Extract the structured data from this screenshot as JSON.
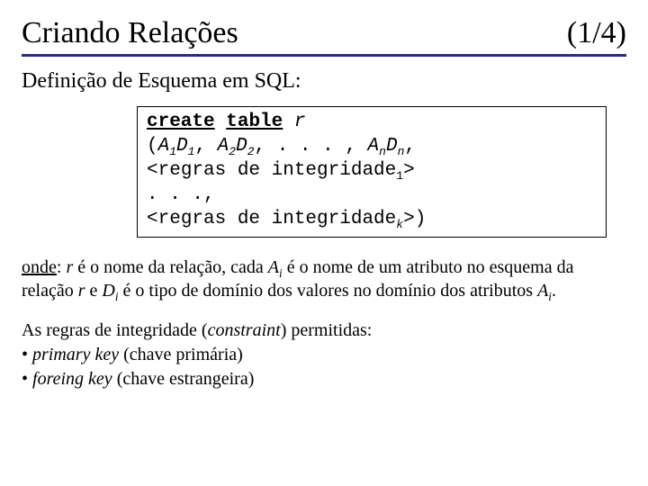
{
  "title": "Criando Relações",
  "page_label": "(1/4)",
  "subtitle": "Definição de Esquema em SQL:",
  "code": {
    "kw_create": "create",
    "kw_table": "table",
    "r": "r",
    "lparen": "(",
    "A": "A",
    "D": "D",
    "s1": "1",
    "s2": "2",
    "sn": "n",
    "comma_sp": ", ",
    "ellipsis_comma": " . . . , ",
    "lt": "<",
    "gt": ">",
    "rule_txt": "regras de integridade",
    "sk": "k",
    "ellipsis_line": ". . .,",
    "rparen": ")"
  },
  "p1": {
    "onde": "onde",
    "colon": ": ",
    "r": "r",
    "t1": " é o nome da relação, cada ",
    "A": "A",
    "si": "i",
    "t2": " é o nome de um atributo no esquema da relação ",
    "t3": " e ",
    "D": "D",
    "t4": " é o tipo de domínio dos valores no domínio dos atributos ",
    "dot": "."
  },
  "p2": {
    "lead": "As regras de integridade (",
    "constraint": "constraint",
    "lead2": ") permitidas:",
    "b1_prefix": "• ",
    "b1_it": "primary key",
    "b1_rest": " (chave primária)",
    "b2_prefix": "• ",
    "b2_it": "foreing key",
    "b2_rest": " (chave estrangeira)"
  }
}
